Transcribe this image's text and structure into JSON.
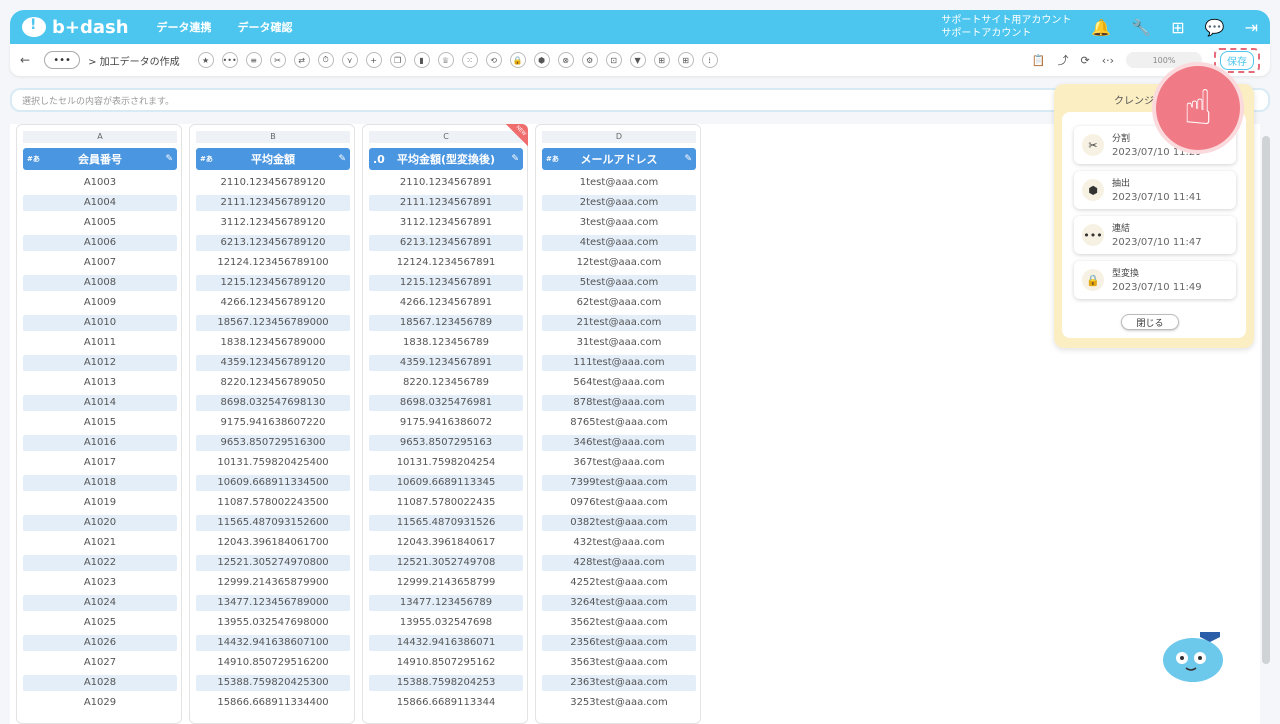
{
  "app": {
    "logo": "b+dash"
  },
  "topnav": [
    "データ連携",
    "データ確認"
  ],
  "account": {
    "line1": "サポートサイト用アカウント",
    "line2": "サポートアカウント"
  },
  "toolbar": {
    "back": "←",
    "more": "•••",
    "breadcrumb": "> 加工データの作成",
    "zoom": "100%",
    "save": "保存",
    "tools": [
      "★",
      "•••",
      "≡",
      "✂",
      "⇄",
      "⏱",
      "⋎",
      "+",
      "❐",
      "▮",
      "♕",
      "⁙",
      "⟲",
      "🔒",
      "⬢",
      "⊗",
      "⚙",
      "⊡",
      "▼",
      "⊞",
      "⊞",
      "⁞"
    ]
  },
  "cellbar": {
    "placeholder": "選択したセルの内容が表示されます。"
  },
  "columns": [
    {
      "letter": "A",
      "title": "会員番号",
      "type": "#あ",
      "values": [
        "A1003",
        "A1004",
        "A1005",
        "A1006",
        "A1007",
        "A1008",
        "A1009",
        "A1010",
        "A1011",
        "A1012",
        "A1013",
        "A1014",
        "A1015",
        "A1016",
        "A1017",
        "A1018",
        "A1019",
        "A1020",
        "A1021",
        "A1022",
        "A1023",
        "A1024",
        "A1025",
        "A1026",
        "A1027",
        "A1028",
        "A1029"
      ]
    },
    {
      "letter": "B",
      "title": "平均金額",
      "type": "#あ",
      "values": [
        "2110.123456789120",
        "2111.123456789120",
        "3112.123456789120",
        "6213.123456789120",
        "12124.123456789100",
        "1215.123456789120",
        "4266.123456789120",
        "18567.123456789000",
        "1838.123456789000",
        "4359.123456789120",
        "8220.123456789050",
        "8698.032547698130",
        "9175.941638607220",
        "9653.850729516300",
        "10131.759820425400",
        "10609.668911334500",
        "11087.578002243500",
        "11565.487093152600",
        "12043.396184061700",
        "12521.305274970800",
        "12999.214365879900",
        "13477.123456789000",
        "13955.032547698000",
        "14432.941638607100",
        "14910.850729516200",
        "15388.759820425300",
        "15866.668911334400"
      ]
    },
    {
      "letter": "C",
      "title": "平均金額(型変換後)",
      "type": ".0",
      "isNew": true,
      "newLabel": "NEW",
      "values": [
        "2110.1234567891",
        "2111.1234567891",
        "3112.1234567891",
        "6213.1234567891",
        "12124.1234567891",
        "1215.1234567891",
        "4266.1234567891",
        "18567.123456789",
        "1838.123456789",
        "4359.1234567891",
        "8220.123456789",
        "8698.0325476981",
        "9175.9416386072",
        "9653.8507295163",
        "10131.7598204254",
        "10609.6689113345",
        "11087.5780022435",
        "11565.4870931526",
        "12043.3961840617",
        "12521.3052749708",
        "12999.2143658799",
        "13477.123456789",
        "13955.032547698",
        "14432.9416386071",
        "14910.8507295162",
        "15388.7598204253",
        "15866.6689113344"
      ]
    },
    {
      "letter": "D",
      "title": "メールアドレス",
      "type": "#あ",
      "values": [
        "1test@aaa.com",
        "2test@aaa.com",
        "3test@aaa.com",
        "4test@aaa.com",
        "12test@aaa.com",
        "5test@aaa.com",
        "62test@aaa.com",
        "21test@aaa.com",
        "31test@aaa.com",
        "111test@aaa.com",
        "564test@aaa.com",
        "878test@aaa.com",
        "8765test@aaa.com",
        "346test@aaa.com",
        "367test@aaa.com",
        "7399test@aaa.com",
        "0976test@aaa.com",
        "0382test@aaa.com",
        "432test@aaa.com",
        "428test@aaa.com",
        "4252test@aaa.com",
        "3264test@aaa.com",
        "3562test@aaa.com",
        "2356test@aaa.com",
        "3563test@aaa.com",
        "2363test@aaa.com",
        "3253test@aaa.com"
      ]
    }
  ],
  "panel": {
    "title": "クレンジ",
    "history": [
      {
        "icon": "✂",
        "name": "分割",
        "time": "2023/07/10 11:29"
      },
      {
        "icon": "⬢",
        "name": "抽出",
        "time": "2023/07/10 11:41"
      },
      {
        "icon": "•••",
        "name": "連結",
        "time": "2023/07/10 11:47"
      },
      {
        "icon": "🔒",
        "name": "型変換",
        "time": "2023/07/10 11:49"
      }
    ],
    "close": "閉じる"
  },
  "colors": {
    "header": "#4cc6ee",
    "columnHead": "#4b96e0",
    "accentPink": "#f07b86"
  }
}
